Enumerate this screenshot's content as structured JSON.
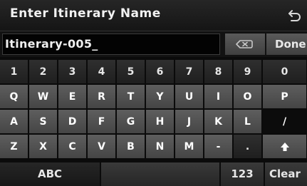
{
  "header": {
    "title": "Enter Itinerary Name",
    "back_icon": "back-arrow-icon"
  },
  "input": {
    "value": "Itinerary-005_",
    "backspace_icon": "backspace-icon",
    "done_label": "Done"
  },
  "keyboard": {
    "rows": [
      [
        "1",
        "2",
        "3",
        "4",
        "5",
        "6",
        "7",
        "8",
        "9",
        "0"
      ],
      [
        "Q",
        "W",
        "E",
        "R",
        "T",
        "Y",
        "U",
        "I",
        "O",
        "P"
      ],
      [
        "A",
        "S",
        "D",
        "F",
        "G",
        "H",
        "J",
        "K",
        "L",
        "/"
      ],
      [
        "Z",
        "X",
        "C",
        "V",
        "B",
        "N",
        "M",
        "-",
        ".",
        "shift"
      ]
    ],
    "shift_icon": "shift-arrow-icon"
  },
  "bottom": {
    "abc_label": "ABC",
    "numeric_label": "123",
    "clear_label": "Clear"
  }
}
